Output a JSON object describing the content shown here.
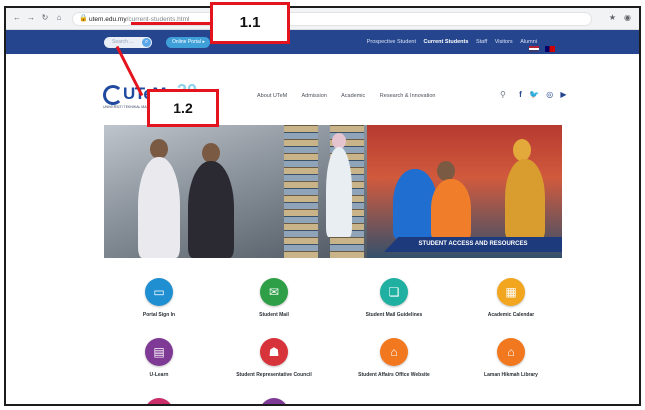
{
  "browser": {
    "url_host": "utem.edu.my",
    "url_path": "/current-students.html"
  },
  "topbar": {
    "search_placeholder": "Search ...",
    "login_label": "Online Portal",
    "links": [
      "Prospective Student",
      "Current Students",
      "Staff",
      "Visitors",
      "Alumni"
    ],
    "active_link": "Current Students"
  },
  "logo": {
    "text": "UTeM",
    "subtitle": "UNIVERSITI TEKNIKAL MALAYSIA MELAKA",
    "anniversary": "30"
  },
  "mainnav": [
    "About UTeM",
    "Admission",
    "Academic",
    "Research & Innovation"
  ],
  "hero": {
    "caption": "STUDENT ACCESS AND RESOURCES"
  },
  "tiles": [
    {
      "label": "Portal Sign In",
      "color": "#1f8fd1",
      "icon": "laptop-icon"
    },
    {
      "label": "Student Mail",
      "color": "#2e9e47",
      "icon": "mail-icon"
    },
    {
      "label": "Student Mail Guidelines",
      "color": "#1fb0a2",
      "icon": "guideline-icon"
    },
    {
      "label": "Academic Calendar",
      "color": "#f2a51f",
      "icon": "calendar-icon"
    },
    {
      "label": "U-Learn",
      "color": "#7e3a95",
      "icon": "elearning-icon"
    },
    {
      "label": "Student Representative Council",
      "color": "#d6333a",
      "icon": "council-icon"
    },
    {
      "label": "Student Affairs Office Website",
      "color": "#f2781f",
      "icon": "home-icon"
    },
    {
      "label": "Laman Hikmah Library",
      "color": "#f2781f",
      "icon": "library-icon"
    }
  ],
  "annotations": {
    "first": "1.1",
    "second": "1.2"
  }
}
